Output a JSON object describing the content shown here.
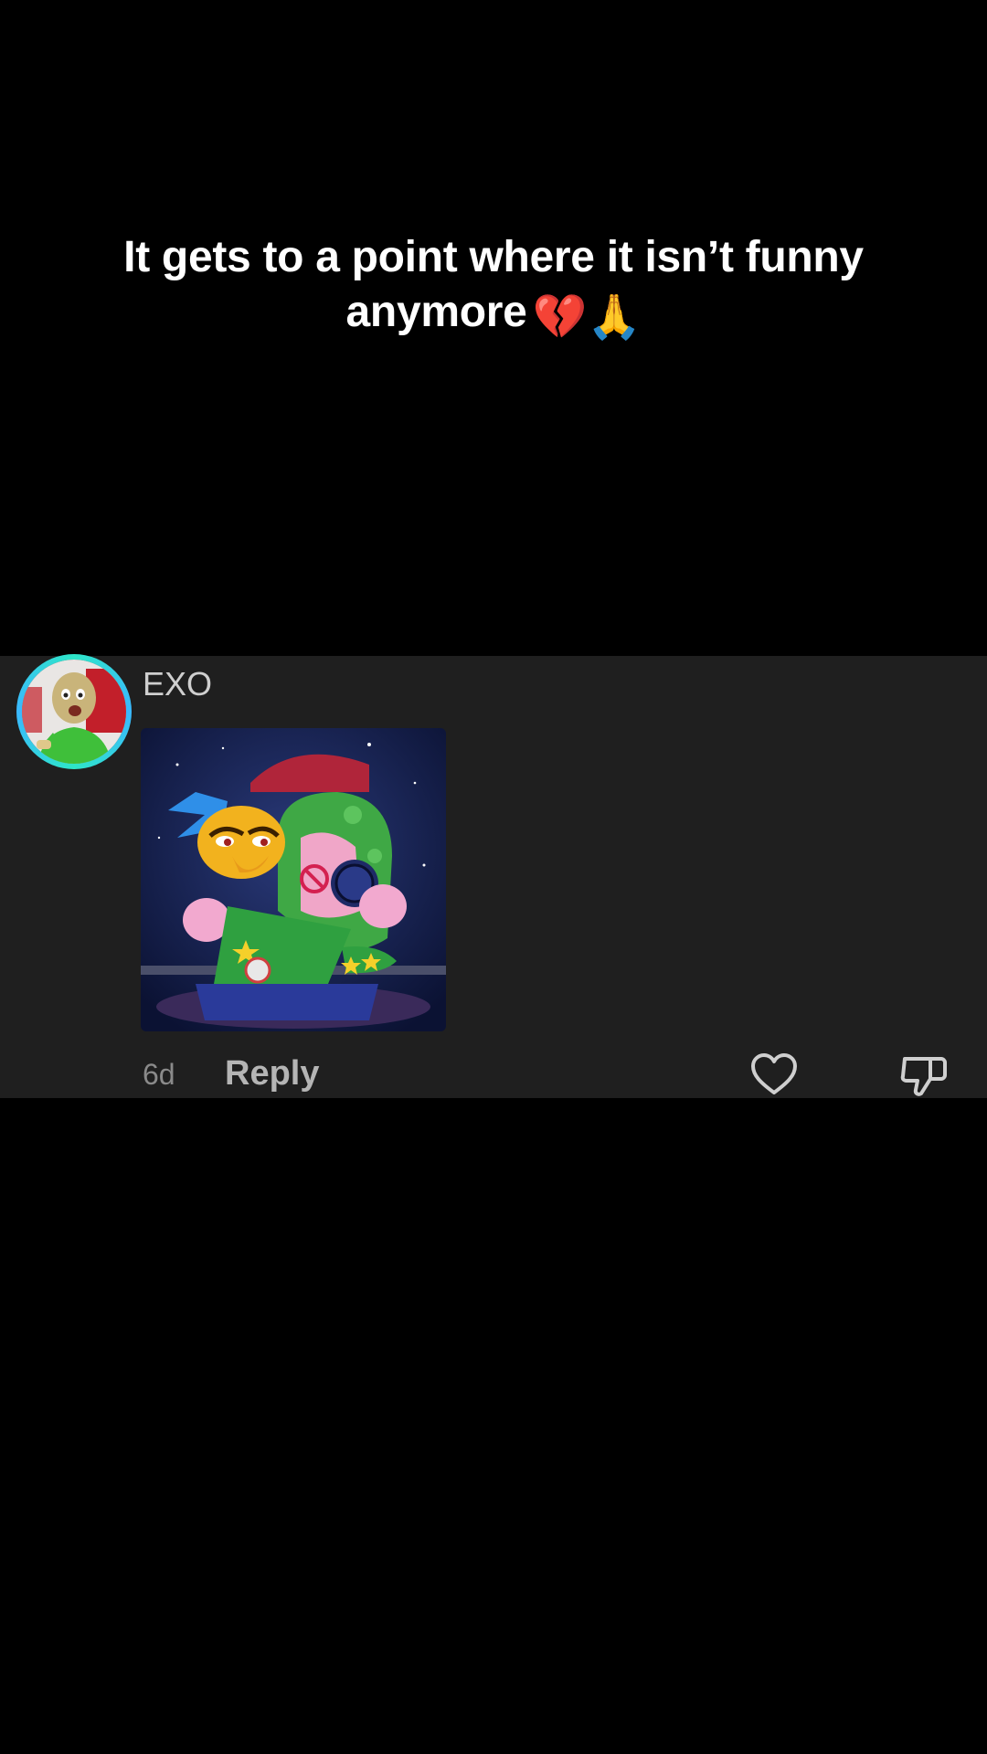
{
  "caption": {
    "text": "It gets to a point where it isn’t funny anymore",
    "line1": "It gets to a point where it isn’t funny",
    "line2": "anymore",
    "emojis": "💔🙏"
  },
  "comment": {
    "username": "EXO",
    "time": "6d",
    "reply_label": "Reply",
    "avatar_icon": "green-character-avatar-icon",
    "sticker_icon": "cartoon-character-sticker-icon"
  },
  "icons": {
    "like": "heart-icon",
    "dislike": "thumbs-down-icon"
  },
  "colors": {
    "background": "#000000",
    "card": "#1f1f1f",
    "avatar_ring": "#2ee6c8",
    "username": "#cfcfcf",
    "muted": "#8a8a8a"
  }
}
